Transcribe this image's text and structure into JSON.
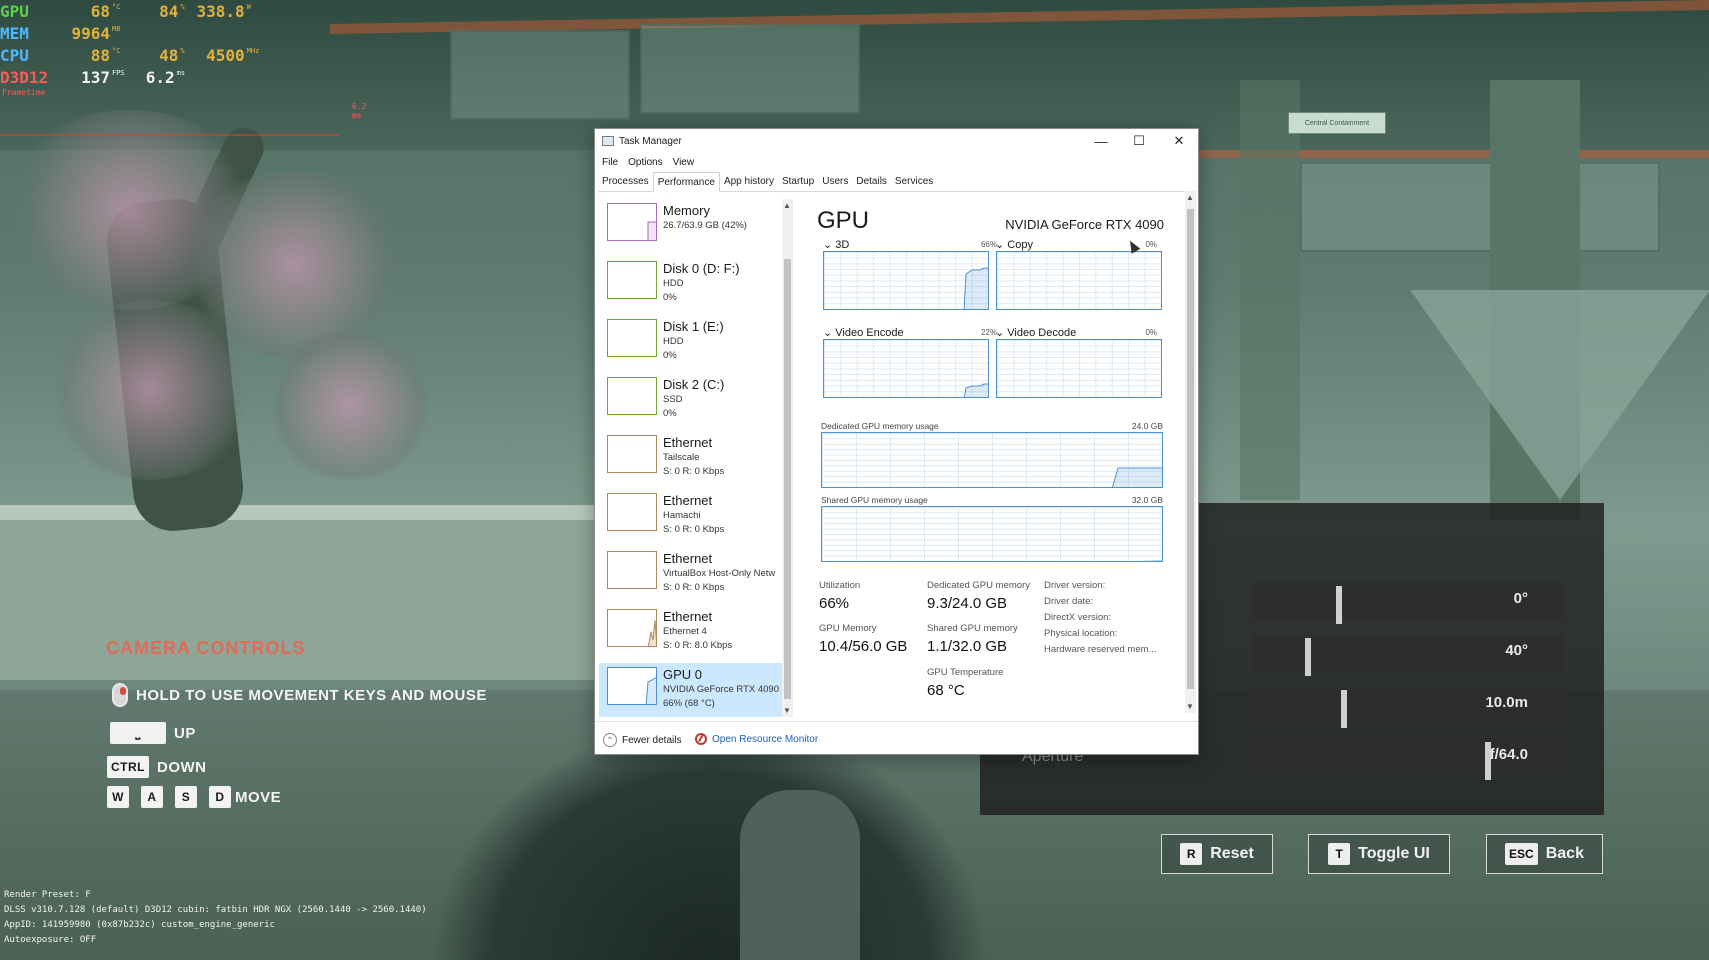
{
  "osd": {
    "gpu": {
      "label": "GPU",
      "temp": "68",
      "temp_unit": "°C",
      "load": "84",
      "load_unit": "%",
      "power": "338.8",
      "power_unit": "W"
    },
    "mem": {
      "label": "MEM",
      "value": "9964",
      "unit": "MB"
    },
    "cpu": {
      "label": "CPU",
      "temp": "88",
      "temp_unit": "°C",
      "load": "48",
      "load_unit": "%",
      "clock": "4500",
      "clock_unit": "MHz"
    },
    "api": {
      "label": "D3D12",
      "fps": "137",
      "fps_unit": "FPS",
      "frametime": "6.2",
      "frametime_unit": "ms"
    },
    "frametime_label": "Frametime",
    "frametime_small": "6.2 ms",
    "colors": {
      "gpu": "#5fd04a",
      "mem": "#4fb8ff",
      "cpu": "#4fb8ff",
      "api": "#ff5a5a",
      "values": "#e2b23a"
    }
  },
  "debug": {
    "lines": [
      "Render Preset: F",
      "DLSS v310.7.128 (default) D3D12 cubin: fatbin HDR NGX (2560.1440 -> 2560.1440)",
      "AppID: 141959980 (0x87b232c) custom_engine_generic",
      "Autoexposure: OFF"
    ]
  },
  "exit_sign": "Central Containment",
  "camera_controls": {
    "title": "CAMERA CONTROLS",
    "hold": "HOLD TO USE MOVEMENT KEYS AND MOUSE",
    "up_label": "UP",
    "ctrl_key": "CTRL",
    "down_label": "DOWN",
    "keys": [
      "W",
      "A",
      "S",
      "D"
    ],
    "move_label": "MOVE"
  },
  "photo_mode": {
    "sliders": [
      {
        "value": "0°",
        "level": 0.35
      },
      {
        "value": "40°",
        "level": 0.22
      },
      {
        "value": "10.0m",
        "level": 0.37
      },
      {
        "value": "f/64.0",
        "level": 0.97
      }
    ],
    "aperture_label": "Aperture",
    "buttons": [
      {
        "key": "R",
        "label": "Reset"
      },
      {
        "key": "T",
        "label": "Toggle UI"
      },
      {
        "key": "ESC",
        "label": "Back"
      }
    ]
  },
  "task_manager": {
    "title": "Task Manager",
    "controls": {
      "minimize": "—",
      "maximize": "☐",
      "close": "✕"
    },
    "menu": [
      "File",
      "Options",
      "View"
    ],
    "tabs": [
      "Processes",
      "Performance",
      "App history",
      "Startup",
      "Users",
      "Details",
      "Services"
    ],
    "active_tab": "Performance",
    "resources": [
      {
        "name": "Memory",
        "sub": "26.7/63.9 GB (42%)",
        "sub2": "",
        "kind": "mem"
      },
      {
        "name": "Disk 0 (D: F:)",
        "sub": "HDD",
        "sub2": "0%",
        "kind": "disk"
      },
      {
        "name": "Disk 1 (E:)",
        "sub": "HDD",
        "sub2": "0%",
        "kind": "disk"
      },
      {
        "name": "Disk 2 (C:)",
        "sub": "SSD",
        "sub2": "0%",
        "kind": "disk"
      },
      {
        "name": "Ethernet",
        "sub": "Tailscale",
        "sub2": "S: 0 R: 0 Kbps",
        "kind": "eth"
      },
      {
        "name": "Ethernet",
        "sub": "Hamachi",
        "sub2": "S: 0 R: 0 Kbps",
        "kind": "eth"
      },
      {
        "name": "Ethernet",
        "sub": "VirtualBox Host-Only Netw",
        "sub2": "S: 0 R: 0 Kbps",
        "kind": "eth"
      },
      {
        "name": "Ethernet",
        "sub": "Ethernet 4",
        "sub2": "S: 0 R: 8.0 Kbps",
        "kind": "eth"
      },
      {
        "name": "GPU 0",
        "sub": "NVIDIA GeForce RTX 4090",
        "sub2": "66% (68 °C)",
        "kind": "gpu"
      }
    ],
    "gpu": {
      "heading": "GPU",
      "model": "NVIDIA GeForce RTX 4090",
      "engines": [
        {
          "name": "3D",
          "pct": "66%"
        },
        {
          "name": "Copy",
          "pct": "0%"
        },
        {
          "name": "Video Encode",
          "pct": "22%"
        },
        {
          "name": "Video Decode",
          "pct": "0%"
        }
      ],
      "dedicated_label": "Dedicated GPU memory usage",
      "dedicated_max": "24.0 GB",
      "shared_label": "Shared GPU memory usage",
      "shared_max": "32.0 GB",
      "stats": {
        "utilization_label": "Utilization",
        "utilization": "66%",
        "dedicated_mem_label": "Dedicated GPU memory",
        "dedicated_mem": "9.3/24.0 GB",
        "gpu_memory_label": "GPU Memory",
        "gpu_memory": "10.4/56.0 GB",
        "shared_mem_label": "Shared GPU memory",
        "shared_mem": "1.1/32.0 GB",
        "temp_label": "GPU Temperature",
        "temp": "68 °C"
      },
      "driver_labels": [
        "Driver version:",
        "Driver date:",
        "DirectX version:",
        "Physical location:",
        "Hardware reserved mem..."
      ]
    },
    "footer": {
      "fewer_details": "Fewer details",
      "open_resource_monitor": "Open Resource Monitor"
    }
  }
}
